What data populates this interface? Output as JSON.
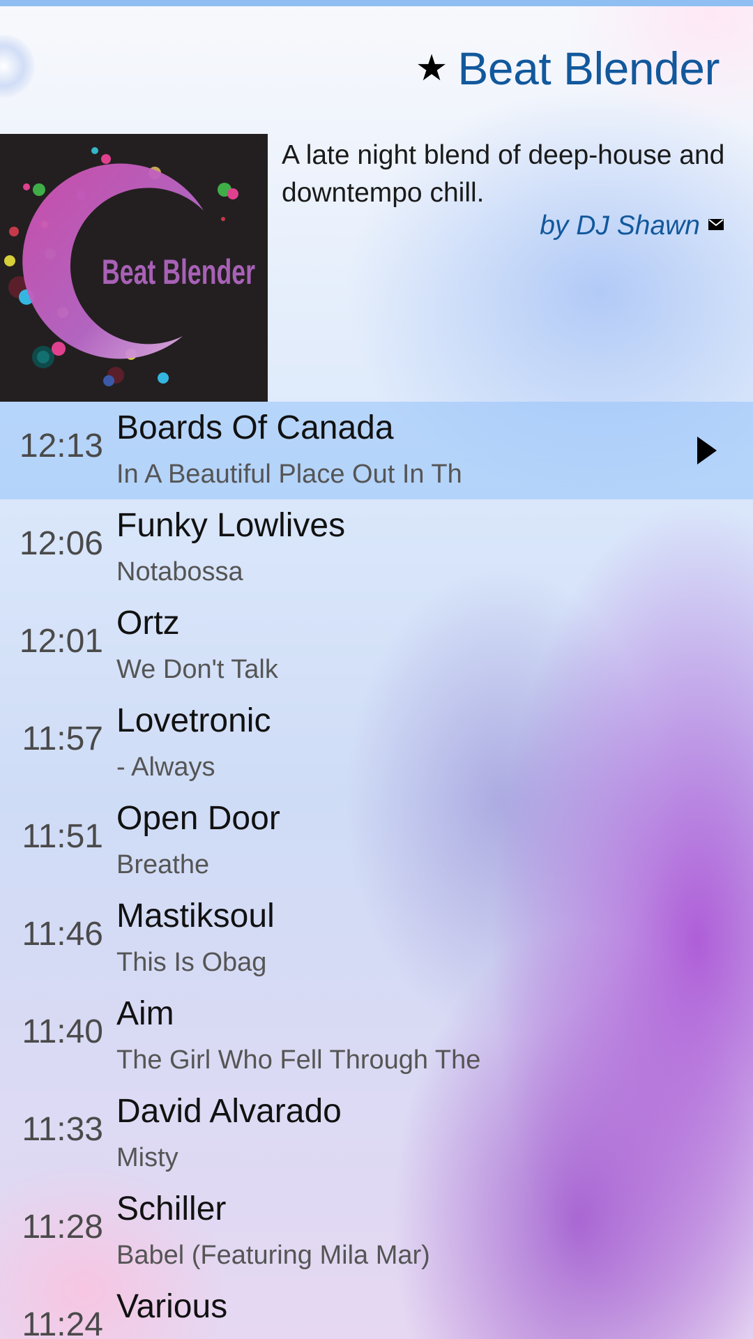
{
  "header": {
    "icon": "star-icon",
    "title": "Beat Blender"
  },
  "album": {
    "cover_text": "Beat Blender",
    "description": "A late night blend of deep-house and downtempo chill.",
    "author": "by DJ Shawn",
    "author_icon": "mail-icon"
  },
  "colors": {
    "accent": "#12589c",
    "topbar": "#8fbff2",
    "active_row": "#96c3fa",
    "cover_bg": "#231f20",
    "cover_text": "#a861b6"
  },
  "playlist": [
    {
      "time": "12:13",
      "artist": "Boards Of Canada",
      "track": "In A Beautiful Place Out In Th",
      "active": true
    },
    {
      "time": "12:06",
      "artist": "Funky Lowlives",
      "track": "Notabossa"
    },
    {
      "time": "12:01",
      "artist": "Ortz",
      "track": "We Don't Talk"
    },
    {
      "time": "11:57",
      "artist": "Lovetronic",
      "track": "- Always"
    },
    {
      "time": "11:51",
      "artist": "Open Door",
      "track": "Breathe"
    },
    {
      "time": "11:46",
      "artist": "Mastiksoul",
      "track": "This Is Obag"
    },
    {
      "time": "11:40",
      "artist": "Aim",
      "track": "The Girl Who Fell Through The"
    },
    {
      "time": "11:33",
      "artist": "David Alvarado",
      "track": "Misty"
    },
    {
      "time": "11:28",
      "artist": "Schiller",
      "track": "Babel (Featuring Mila Mar)"
    },
    {
      "time": "11:24",
      "artist": "Various",
      "track": ""
    }
  ]
}
